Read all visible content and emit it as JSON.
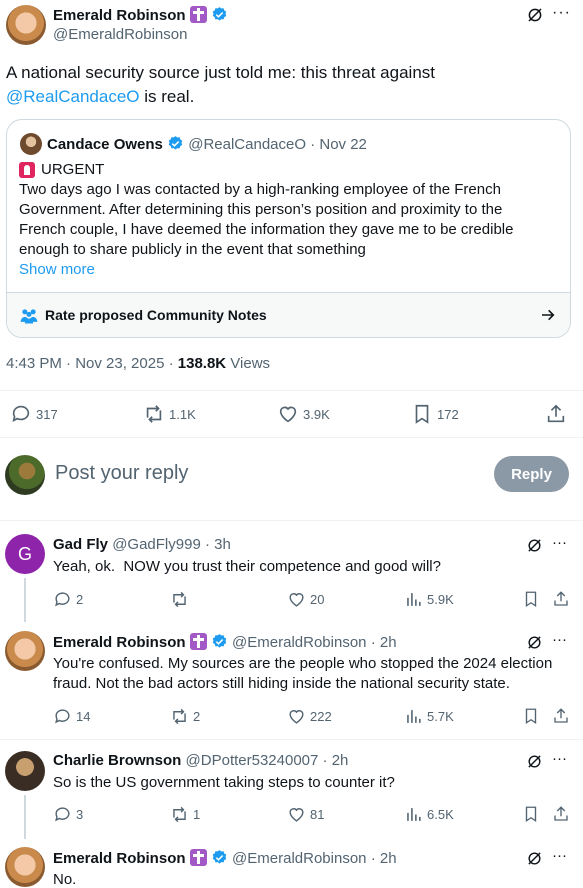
{
  "main_tweet": {
    "author_name": "Emerald Robinson",
    "author_handle": "@EmeraldRobinson",
    "text_before": "A national security source just told me: this threat against",
    "mention": "@RealCandaceO",
    "text_after": " is real.",
    "timestamp": "4:43 PM · Nov 23, 2025 · ",
    "views_count": "138.8K",
    "views_label": " Views",
    "stats": {
      "replies": "317",
      "reposts": "1.1K",
      "likes": "3.9K",
      "bookmarks": "172"
    }
  },
  "quoted_tweet": {
    "author_name": "Candace Owens",
    "author_handle": "@RealCandaceO",
    "date": "· Nov 22",
    "urgent_label": "URGENT",
    "body": "Two days ago I was contacted by a high-ranking employee of the French Government. After determining this person’s position and proximity to the French couple, I have deemed the information they gave me to be credible enough to share publicly in the event that something",
    "show_more": "Show more",
    "community_notes": "Rate proposed Community Notes"
  },
  "reply_box": {
    "placeholder": "Post your reply",
    "button": "Reply"
  },
  "replies": [
    {
      "name": "Gad Fly",
      "handle": "@GadFly999",
      "time": "· 3h",
      "avatar_letter": "G",
      "text": "Yeah, ok.  NOW you trust their competence and good will?",
      "replies": "2",
      "reposts": "",
      "likes": "20",
      "views": "5.9K"
    },
    {
      "name": "Emerald Robinson",
      "handle": "@EmeraldRobinson",
      "time": "· 2h",
      "text": "You're confused. My sources are the people who stopped the 2024 election fraud. Not the bad actors still hiding inside the national security state.",
      "replies": "14",
      "reposts": "2",
      "likes": "222",
      "views": "5.7K"
    },
    {
      "name": "Charlie Brownson",
      "handle": "@DPotter53240007",
      "time": "· 2h",
      "text": "So is the US government taking steps to counter it?",
      "replies": "3",
      "reposts": "1",
      "likes": "81",
      "views": "6.5K"
    },
    {
      "name": "Emerald Robinson",
      "handle": "@EmeraldRobinson",
      "time": "· 2h",
      "text": "No."
    }
  ],
  "colors": {
    "accent": "#1d9bf0",
    "text": "#0f1419",
    "muted": "#536471",
    "divider": "#eff3f4",
    "badge_purple": "#a259c6"
  }
}
